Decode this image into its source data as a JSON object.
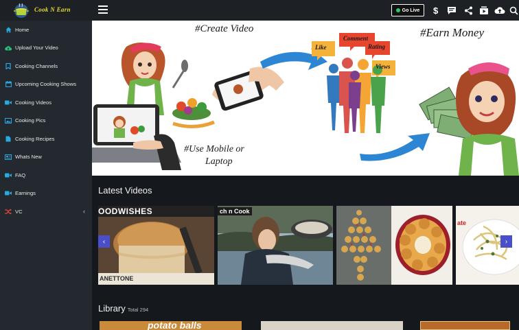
{
  "app": {
    "brand": "Cook N Earn",
    "accent": "#4a4fc9",
    "sidebar_bg": "#23292e",
    "topbar_bg": "#1d2125",
    "icon_blue": "#27a9e1"
  },
  "header": {
    "go_live_label": "Go Live",
    "icons": [
      "menu-icon",
      "dollar-icon",
      "chat-icon",
      "share-icon",
      "video-upload-icon",
      "cloud-upload-icon",
      "search-icon"
    ]
  },
  "sidebar": {
    "items": [
      {
        "label": "Home",
        "icon": "home-icon"
      },
      {
        "label": "Upload Your Video",
        "icon": "cloud-upload-icon"
      },
      {
        "label": "Cooking Channels",
        "icon": "bookmark-icon"
      },
      {
        "label": "Upcoming Cooking Shows",
        "icon": "calendar-icon"
      },
      {
        "label": "Cooking Videos",
        "icon": "video-camera-icon"
      },
      {
        "label": "Cooking Pics",
        "icon": "image-icon"
      },
      {
        "label": "Cooking Recipes",
        "icon": "document-icon"
      },
      {
        "label": "Whats New",
        "icon": "newspaper-icon"
      },
      {
        "label": "FAQ",
        "icon": "video-camera-icon"
      },
      {
        "label": "Earnings",
        "icon": "video-camera-icon"
      },
      {
        "label": "VC",
        "icon": "shuffle-icon",
        "expandable": true
      }
    ]
  },
  "banner": {
    "caption_create": "#Create Video",
    "caption_earn": "#Earn Money",
    "caption_mobile": "#Use Mobile or",
    "caption_laptop": "Laptop",
    "bubble_like": "Like",
    "bubble_comment": "Comment",
    "bubble_rating": "Rating",
    "bubble_views": "Views"
  },
  "latest": {
    "title": "Latest Videos",
    "thumbs": [
      {
        "overlay_top": "OODWISHES",
        "overlay_bottom": "ANETTONE"
      },
      {
        "overlay_top": "ch n Cook"
      },
      {
        "overlay_top": ""
      },
      {
        "overlay_top": "ate"
      }
    ]
  },
  "library": {
    "title": "Library",
    "total_label": "Total 294",
    "first_thumb_text": "potato balls"
  }
}
